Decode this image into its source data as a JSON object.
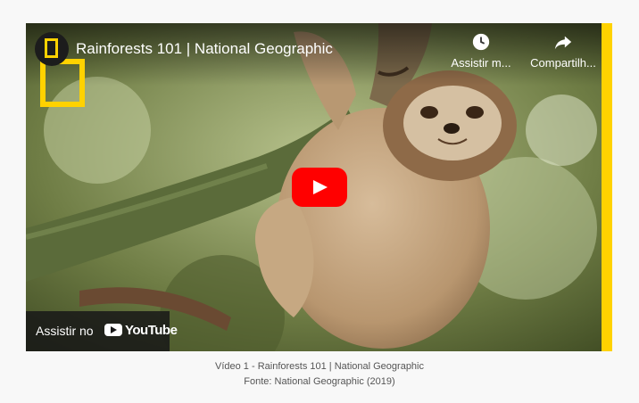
{
  "player": {
    "title": "Rainforests 101 | National Geographic",
    "watch_later_label": "Assistir m...",
    "share_label": "Compartilh...",
    "watch_on_label": "Assistir no",
    "youtube_wordmark": "YouTube",
    "accent_color": "#ffd200",
    "play_button_color": "#ff0000"
  },
  "caption": {
    "line1": "Vídeo 1 - Rainforests 101 | National Geographic",
    "line2": "Fonte: National Geographic (2019)"
  },
  "icons": [
    "national-geographic-icon",
    "clock-icon",
    "share-icon",
    "play-icon",
    "youtube-icon"
  ]
}
